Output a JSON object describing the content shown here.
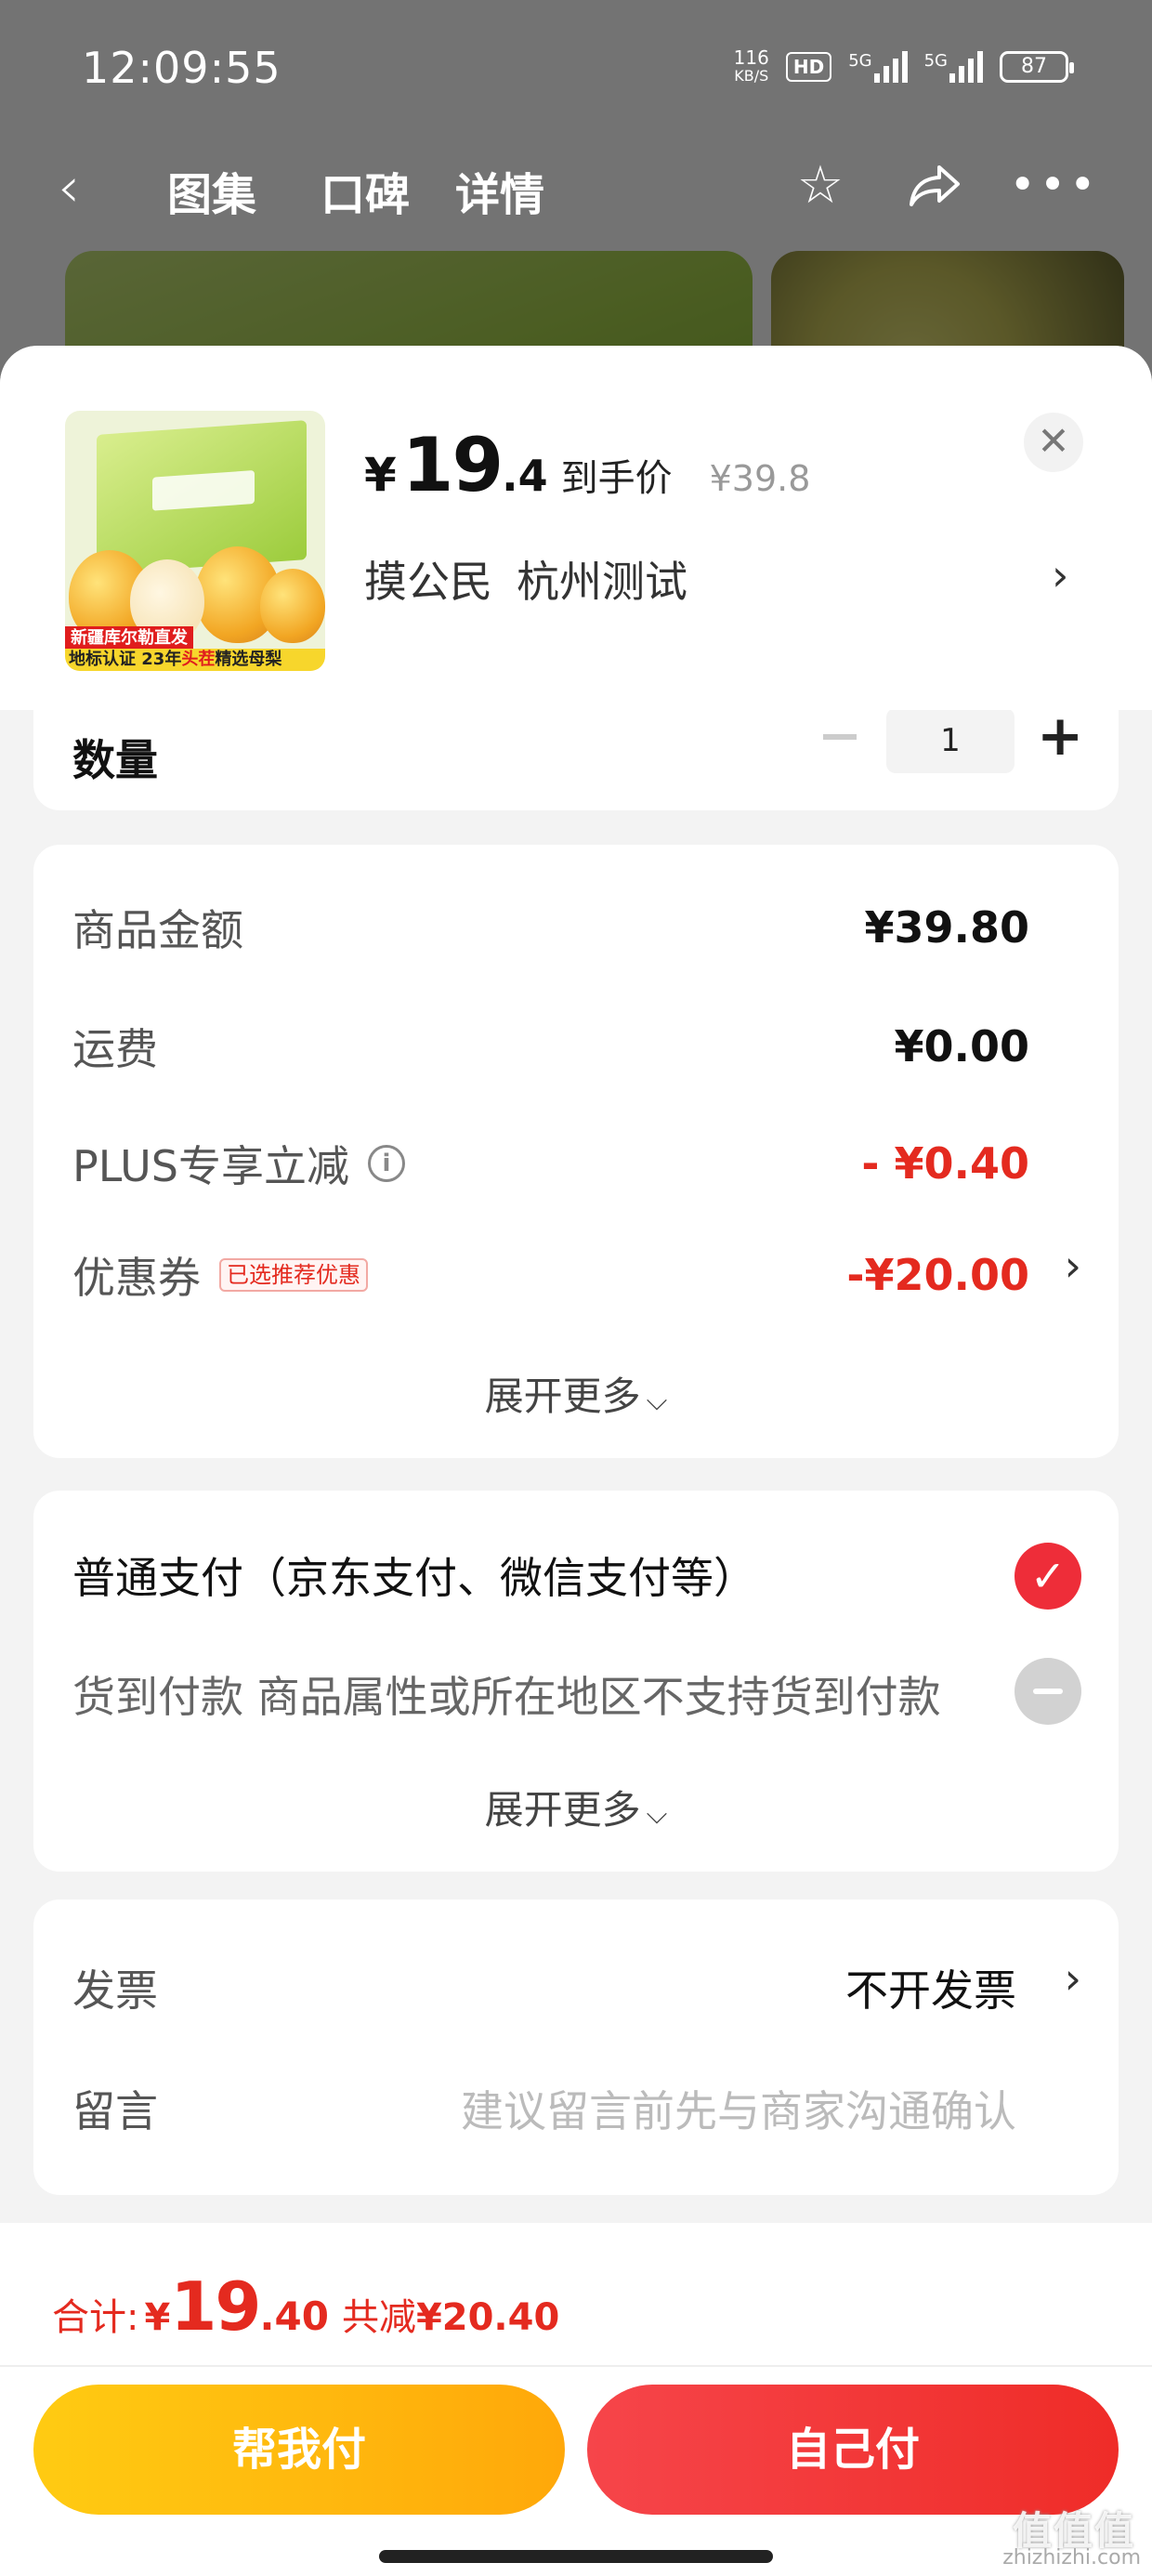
{
  "status_bar": {
    "time": "12:09:55",
    "net_speed_value": "116",
    "net_speed_unit": "KB/S",
    "hd": "HD",
    "signal1": "5G",
    "signal2": "5G",
    "battery": "87"
  },
  "nav": {
    "tabs": [
      "图集",
      "口碑",
      "详情"
    ],
    "back_icon": "chevron-left-icon",
    "star_icon": "star-icon",
    "share_icon": "share-icon",
    "more_icon": "more-icon"
  },
  "product": {
    "thumb_tag1": "新疆库尔勒直发",
    "thumb_tag2_a": "地标认证 23年",
    "thumb_tag2_hl": "头茬",
    "thumb_tag2_b": "精选母梨",
    "price_currency": "¥",
    "price_int": "19",
    "price_dec": ".4",
    "price_label": "到手价",
    "original_price": "¥39.8",
    "address_name": "摸公民",
    "address_city": "杭州测试",
    "close_icon": "close-icon"
  },
  "quantity": {
    "label": "数量",
    "value": "1"
  },
  "amounts": {
    "goods_label": "商品金额",
    "goods_value": "¥39.80",
    "shipping_label": "运费",
    "shipping_value": "¥0.00",
    "plus_label": "PLUS专享立减",
    "plus_value": "- ¥0.40",
    "coupon_label": "优惠券",
    "coupon_tag": "已选推荐优惠",
    "coupon_value": "-¥20.00",
    "expand": "展开更多"
  },
  "payment": {
    "normal": "普通支付（京东支付、微信支付等）",
    "cod": "货到付款 商品属性或所在地区不支持货到付款",
    "expand": "展开更多"
  },
  "misc": {
    "invoice_label": "发票",
    "invoice_value": "不开发票",
    "message_label": "留言",
    "message_placeholder": "建议留言前先与商家沟通确认"
  },
  "footer": {
    "total_label": "合计:",
    "total_currency": "¥",
    "total_int": "19",
    "total_dec": ".40",
    "saved_label": "共减",
    "saved_value": "¥20.40",
    "help_pay": "帮我付",
    "self_pay": "自己付"
  },
  "watermark": {
    "text": "zhizhizhi.com",
    "big": "值值值"
  },
  "colors": {
    "accent_red": "#e42a1f",
    "help_btn": "#ffb80e",
    "self_btn": "#f0302c"
  }
}
